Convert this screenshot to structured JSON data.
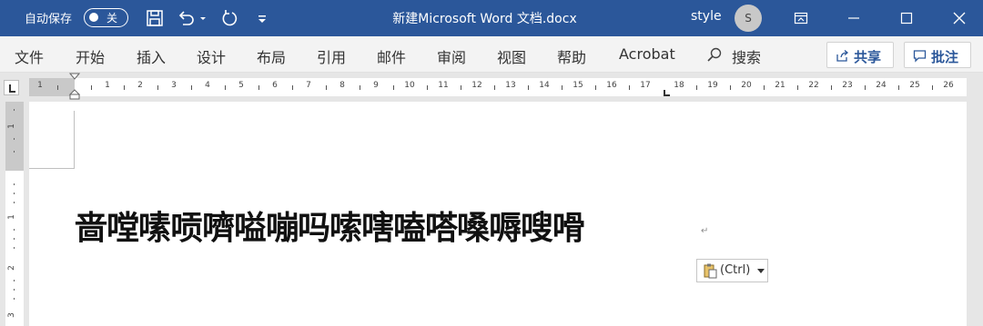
{
  "titlebar": {
    "autosave_label": "自动保存",
    "autosave_state": "关",
    "document_title": "新建Microsoft Word 文档.docx",
    "user_name": "style",
    "user_initial": "S",
    "bg_color": "#2b579a"
  },
  "menu": {
    "items": [
      "文件",
      "开始",
      "插入",
      "设计",
      "布局",
      "引用",
      "邮件",
      "审阅",
      "视图",
      "帮助",
      "Acrobat"
    ],
    "search_label": "搜索",
    "share_label": "共享",
    "comments_label": "批注"
  },
  "ruler": {
    "h_labels": [
      "1",
      "1",
      "1",
      "2",
      "3",
      "4",
      "5",
      "6",
      "7",
      "8",
      "9",
      "10",
      "11",
      "12",
      "13",
      "14",
      "15",
      "16",
      "17",
      "18",
      "19",
      "20",
      "21",
      "22",
      "23",
      "24",
      "25",
      "26"
    ],
    "v_labels": [
      "1",
      "1",
      "2",
      "3"
    ]
  },
  "document": {
    "body_text": "啬嘡嗉唝嚌嗌嘣吗嗦嗐嗑嗒嗓嗕嗖嗗",
    "paragraph_mark": "↵",
    "paste_options_label": "(Ctrl)"
  }
}
